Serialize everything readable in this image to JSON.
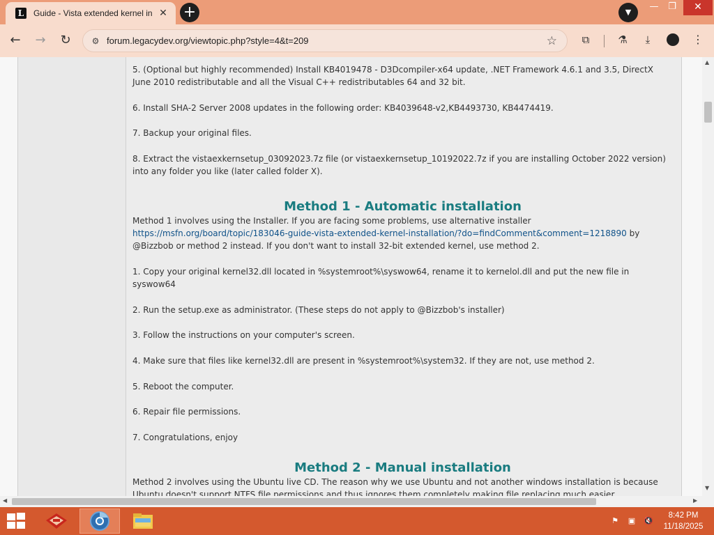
{
  "browser": {
    "tab_title": "Guide - Vista extended kernel in",
    "tab_favicon": "L",
    "url": "forum.legacydev.org/viewtopic.php?style=4&t=209"
  },
  "post": {
    "paragraphs_top": [
      "5. (Optional but highly recommended) Install KB4019478 - D3Dcompiler-x64 update, .NET Framework 4.6.1 and 3.5, DirectX June 2010 redistributable and all the Visual C++ redistributables 64 and 32 bit.",
      "6. Install SHA-2 Server 2008 updates in the following order: KB4039648-v2,KB4493730, KB4474419.",
      "7. Backup your original files.",
      "8. Extract the vistaexkernsetup_03092023.7z file (or vistaexkernsetup_10192022.7z if you are installing October 2022 version) into any folder you like (later called folder X)."
    ],
    "method1": {
      "heading": "Method 1 - Automatic installation",
      "intro_before_link": "Method 1 involves using the Installer. If you are facing some problems, use alternative installer ",
      "link": "https://msfn.org/board/topic/183046-guide-vista-extended-kernel-installation/?do=findComment&comment=1218890",
      "intro_after_link": " by @Bizzbob or method 2 instead. If you don't want to install 32-bit extended kernel, use method 2.",
      "steps": [
        "1. Copy your original kernel32.dll located in %systemroot%\\syswow64, rename it to kernelol.dll and put the new file in syswow64",
        "2. Run the setup.exe as administrator. (These steps do not apply to @Bizzbob's installer)",
        "3. Follow the instructions on your computer's screen.",
        "4. Make sure that files like kernel32.dll are present in %systemroot%\\system32. If they are not, use method 2.",
        "5. Reboot the computer.",
        "6. Repair file permissions.",
        "7. Congratulations, enjoy"
      ]
    },
    "method2": {
      "heading": "Method 2 - Manual installation",
      "intro": "Method 2 involves using the Ubuntu live CD. The reason why we use Ubuntu and not another windows installation is because Ubuntu doesn't support NTFS file permissions and thus ignores them completely making file replacing much easier."
    }
  },
  "taskbar": {
    "clock_time": "8:42 PM",
    "clock_date": "11/18/2025"
  },
  "colors": {
    "accent_title": "#ec9c78",
    "taskbar": "#d4592e",
    "heading": "#1a7c80",
    "link": "#105289"
  }
}
